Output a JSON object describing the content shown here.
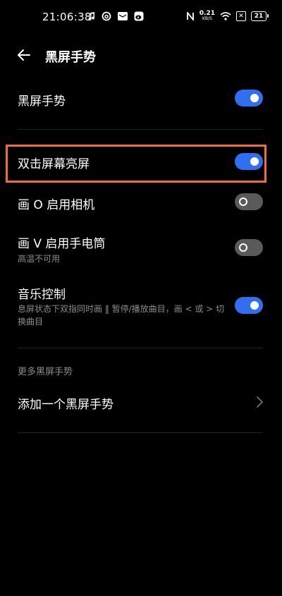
{
  "status": {
    "time": "21:06:38",
    "net_speed_value": "0.21",
    "net_speed_unit": "KB/S",
    "battery": "21",
    "left_icons": [
      "music-note-icon",
      "netease-music-icon",
      "mail-icon",
      "weibo-icon"
    ],
    "right_icons": [
      "nfc-icon",
      "wifi-icon",
      "no-sim-icon",
      "battery-icon"
    ]
  },
  "header": {
    "title": "黑屏手势"
  },
  "settings": {
    "master": {
      "label": "黑屏手势",
      "on": true
    },
    "double_tap": {
      "label": "双击屏幕亮屏",
      "on": true
    },
    "draw_o": {
      "label": "画 O 启用相机",
      "on": false
    },
    "draw_v": {
      "label": "画 V 启用手电筒",
      "sub": "高温不可用",
      "on": false
    },
    "music": {
      "label": "音乐控制",
      "sub": "息屏状态下双指同时画 ‖ 暂停/播放曲目，画 < 或 > 切换曲目",
      "on": true
    }
  },
  "more": {
    "section_title": "更多黑屏手势",
    "add_label": "添加一个黑屏手势"
  },
  "colors": {
    "accent": "#2f6ff0",
    "highlight": "#f26b3a",
    "toggle_off": "#5a5a5a",
    "secondary_text": "#8c8c8c"
  }
}
